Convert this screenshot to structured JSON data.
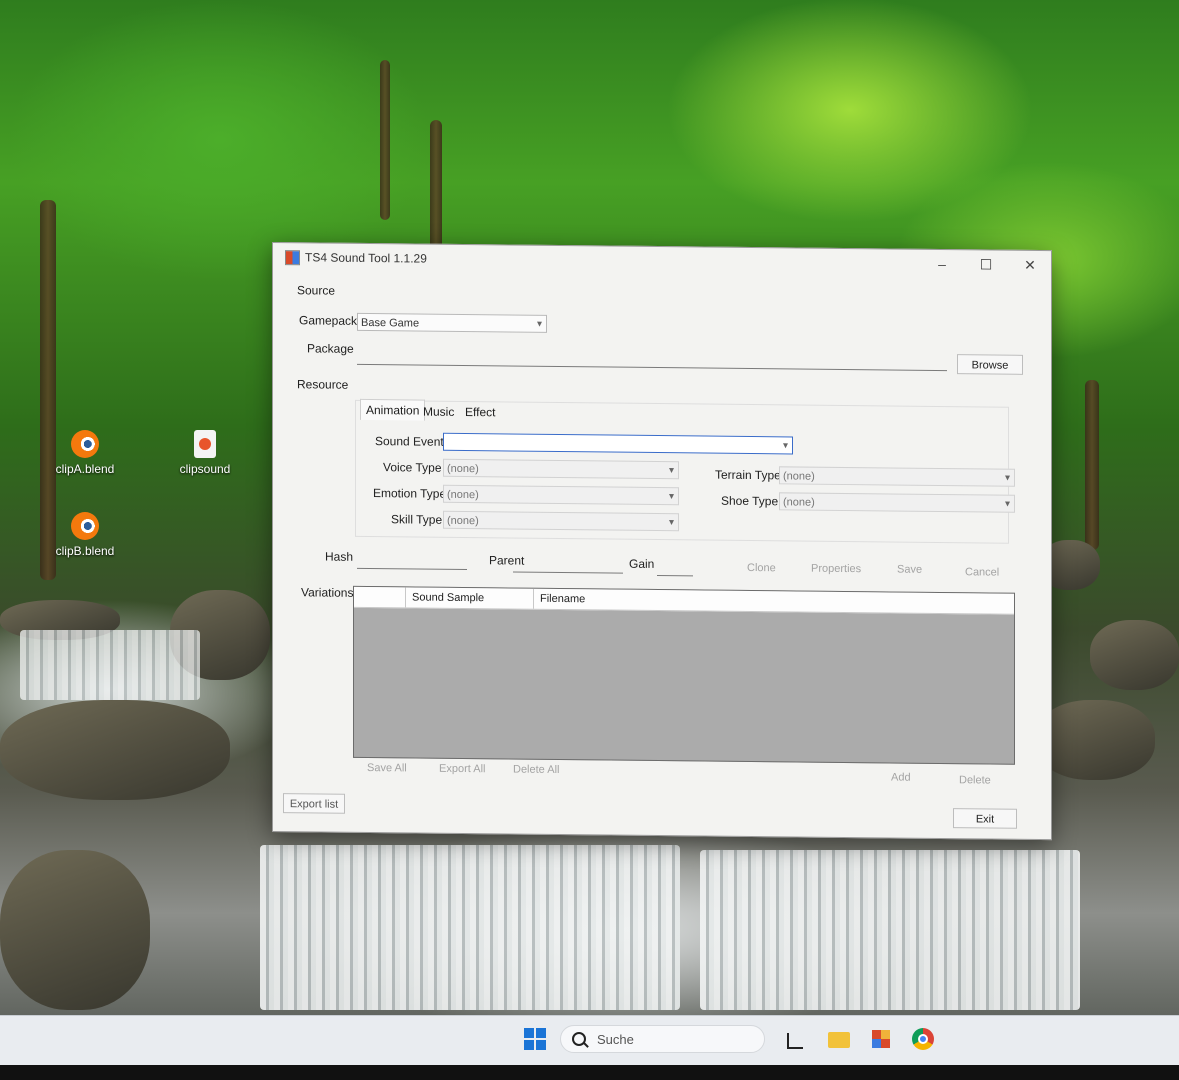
{
  "desktop": {
    "icons": [
      {
        "label": "clipA.blend",
        "icon": "blender-icon"
      },
      {
        "label": "clipsound",
        "icon": "audio-file-icon"
      },
      {
        "label": "clipB.blend",
        "icon": "blender-icon"
      }
    ]
  },
  "window": {
    "title": "TS4 Sound Tool 1.1.29",
    "controls": {
      "minimize": "–",
      "maximize": "☐",
      "close": "✕"
    },
    "source": {
      "heading": "Source",
      "gamepack_label": "Gamepack",
      "gamepack_value": "Base Game",
      "package_label": "Package",
      "package_value": "",
      "browse_label": "Browse"
    },
    "resource": {
      "heading": "Resource",
      "tabs": [
        "Animation",
        "Music",
        "Effect"
      ],
      "active_tab": "Animation",
      "sound_event_label": "Sound Event",
      "sound_event_value": "",
      "voice_type_label": "Voice Type",
      "voice_type_value": "(none)",
      "emotion_type_label": "Emotion Type",
      "emotion_type_value": "(none)",
      "skill_type_label": "Skill Type",
      "skill_type_value": "(none)",
      "terrain_type_label": "Terrain Type",
      "terrain_type_value": "(none)",
      "shoe_type_label": "Shoe Type",
      "shoe_type_value": "(none)"
    },
    "fields": {
      "hash_label": "Hash",
      "parent_label": "Parent",
      "gain_label": "Gain",
      "clone_label": "Clone",
      "properties_label": "Properties",
      "save_label": "Save",
      "cancel_label": "Cancel"
    },
    "variations": {
      "label": "Variations",
      "columns": [
        "",
        "Sound Sample",
        "Filename"
      ],
      "rows": [],
      "save_all_label": "Save All",
      "export_all_label": "Export All",
      "delete_all_label": "Delete All",
      "add_label": "Add",
      "delete_label": "Delete"
    },
    "footer": {
      "export_list_label": "Export list",
      "exit_label": "Exit"
    }
  },
  "taskbar": {
    "search_placeholder": "Suche",
    "apps": [
      "task-view-icon",
      "file-explorer-icon",
      "ts4-sound-tool-icon",
      "chrome-icon"
    ]
  },
  "colors": {
    "accent": "#1a74d6",
    "window_bg": "#f3f3f1",
    "grid_bg": "#ababab"
  }
}
